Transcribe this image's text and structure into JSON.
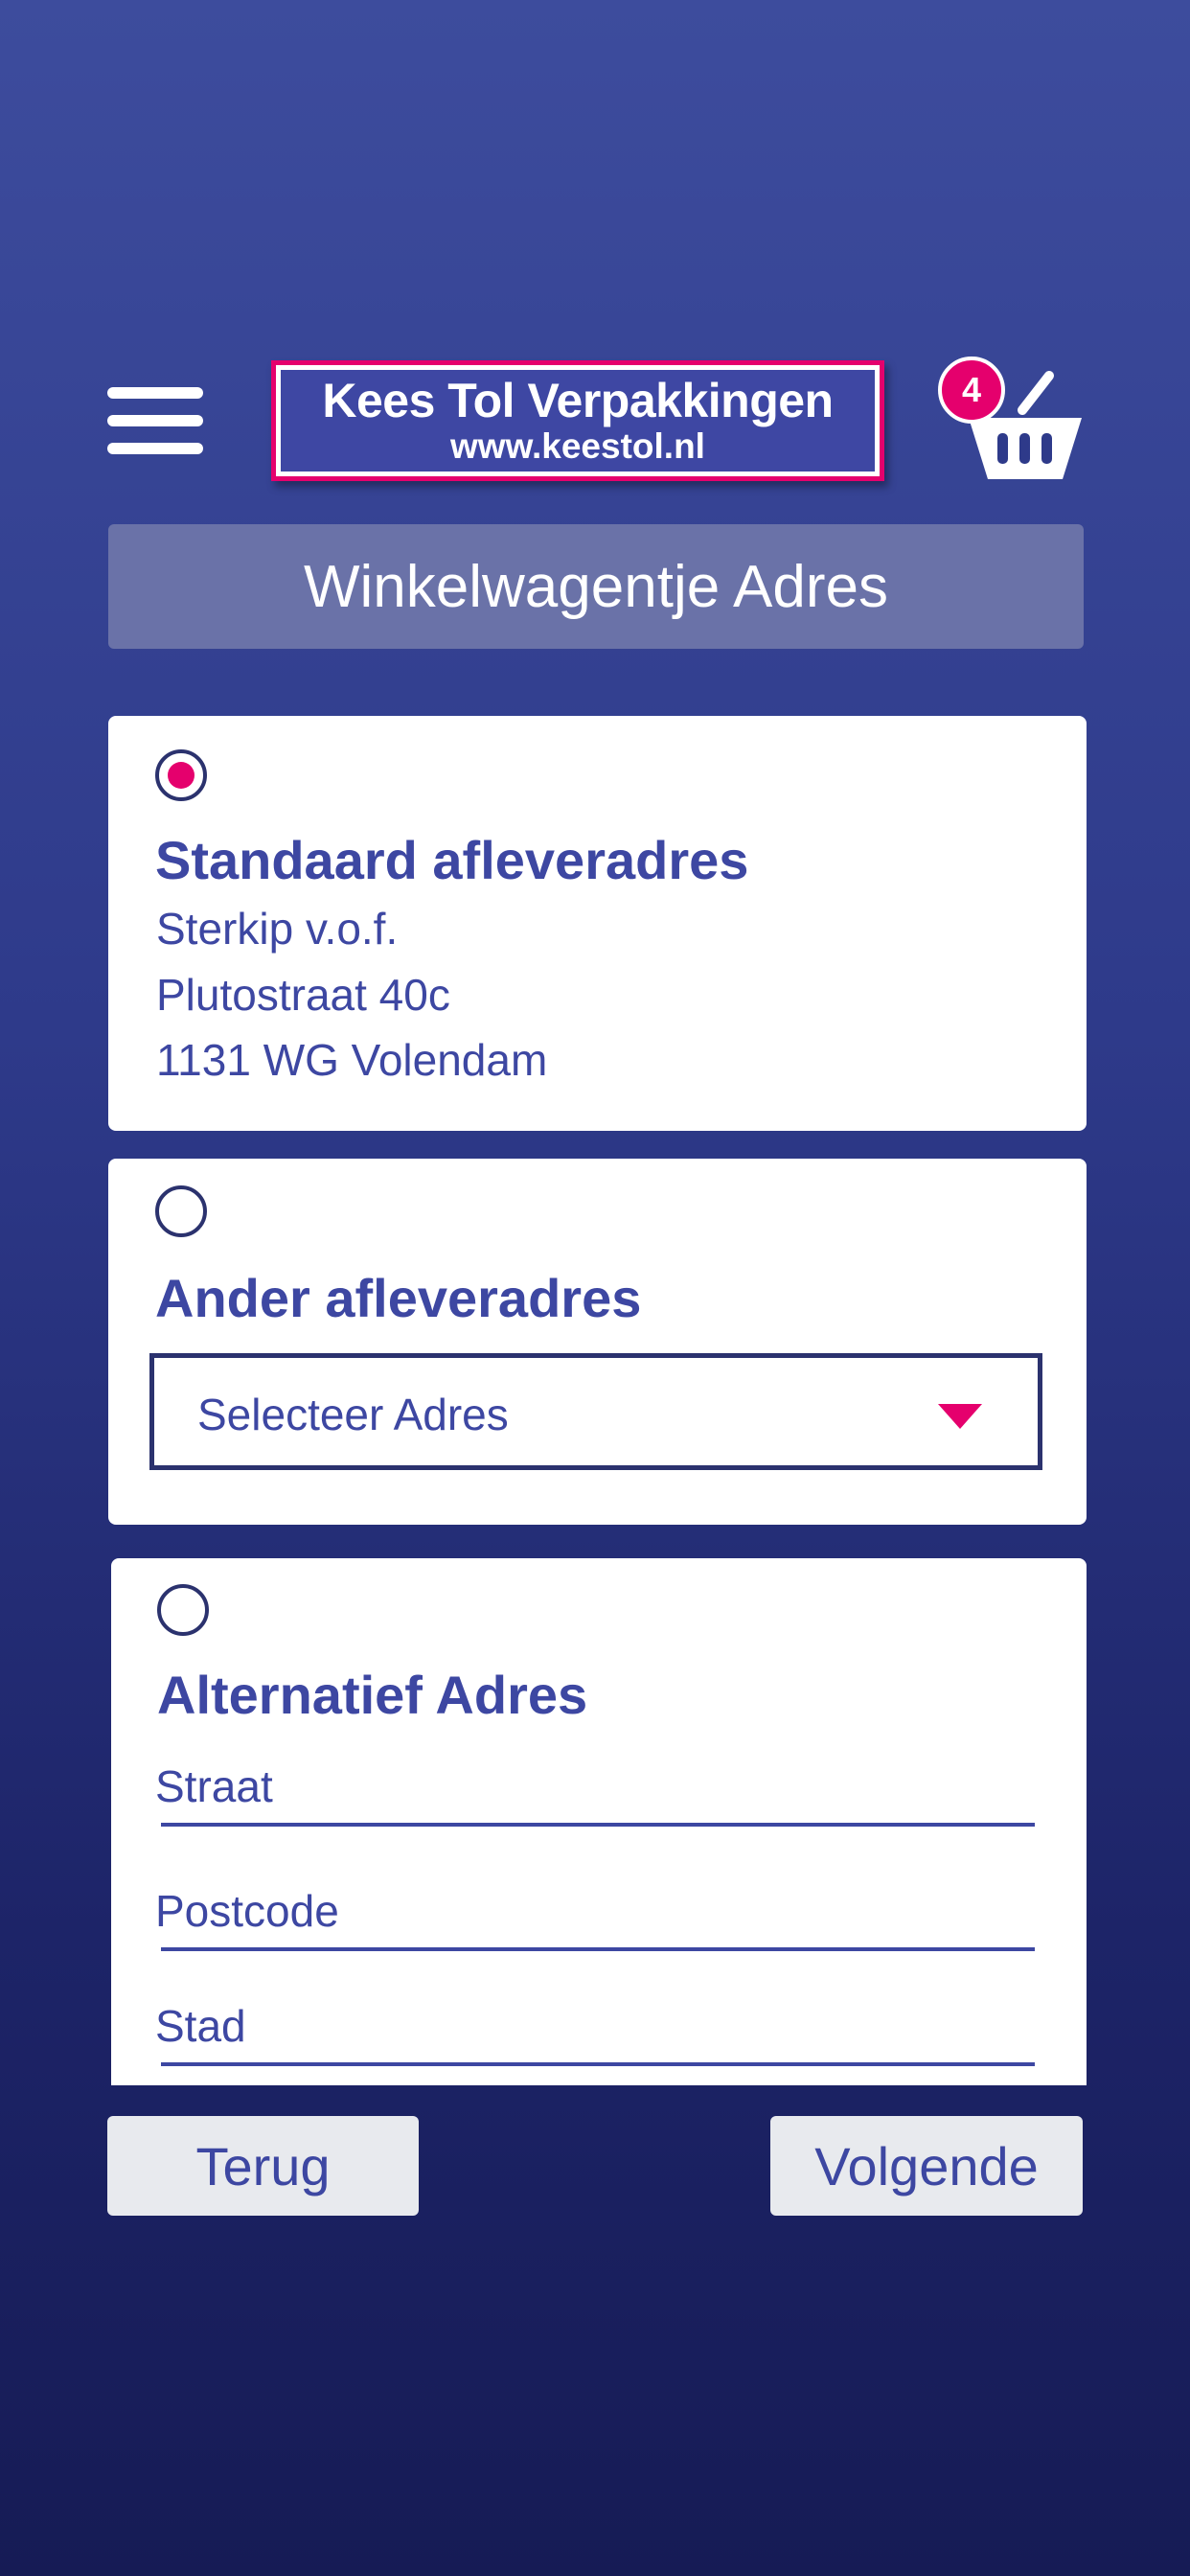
{
  "header": {
    "logo_name": "Kees Tol Verpakkingen",
    "logo_url": "www.keestol.nl",
    "cart_count": "4",
    "menu_icon": "hamburger-icon",
    "cart_icon": "basket-icon"
  },
  "page_title": "Winkelwagentje Adres",
  "options": {
    "default": {
      "selected": true,
      "title": "Standaard afleveradres",
      "lines": [
        "Sterkip v.o.f.",
        "Plutostraat 40c",
        "1131 WG Volendam"
      ]
    },
    "other": {
      "selected": false,
      "title": "Ander afleveradres",
      "select_value": "Selecteer Adres"
    },
    "alternative": {
      "selected": false,
      "title": "Alternatief Adres",
      "street_placeholder": "Straat",
      "postcode_placeholder": "Postcode",
      "city_placeholder": "Stad"
    }
  },
  "buttons": {
    "back": "Terug",
    "next": "Volgende"
  },
  "colors": {
    "accent": "#e5006d",
    "brand_blue": "#3d47a2",
    "background_top": "#3d4c9d",
    "background_bottom": "#161b55"
  }
}
